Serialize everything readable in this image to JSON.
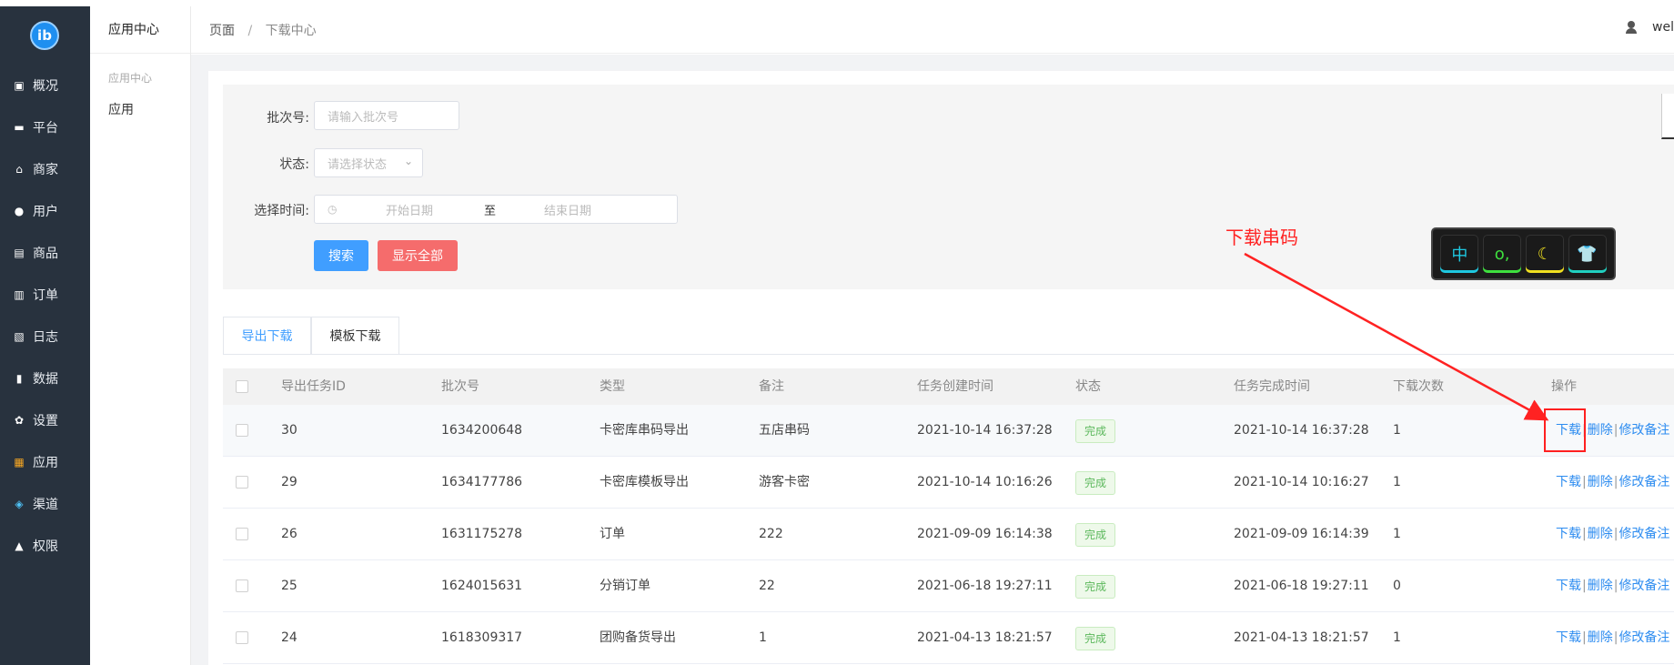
{
  "logo_text": "ib",
  "sidebar": {
    "items": [
      {
        "label": "概况",
        "icon": "overview-icon",
        "glyph": "▣"
      },
      {
        "label": "平台",
        "icon": "monitor-icon",
        "glyph": "▬"
      },
      {
        "label": "商家",
        "icon": "store-icon",
        "glyph": "⌂"
      },
      {
        "label": "用户",
        "icon": "user-icon",
        "glyph": "●"
      },
      {
        "label": "商品",
        "icon": "goods-icon",
        "glyph": "▤"
      },
      {
        "label": "订单",
        "icon": "order-icon",
        "glyph": "▥"
      },
      {
        "label": "日志",
        "icon": "log-icon",
        "glyph": "▧"
      },
      {
        "label": "数据",
        "icon": "bar-chart-icon",
        "glyph": "▮"
      },
      {
        "label": "设置",
        "icon": "gear-icon",
        "glyph": "✿"
      },
      {
        "label": "应用",
        "icon": "apps-grid-icon",
        "glyph": "▦"
      },
      {
        "label": "渠道",
        "icon": "cube-icon",
        "glyph": "◈"
      },
      {
        "label": "权限",
        "icon": "lock-icon",
        "glyph": "▲"
      }
    ]
  },
  "subnav": {
    "title": "应用中心",
    "group": "应用中心",
    "item": "应用"
  },
  "breadcrumb": {
    "root": "页面",
    "separator": "/",
    "current": "下载中心"
  },
  "user": {
    "name": "welia"
  },
  "filter": {
    "batch_label": "批次号:",
    "batch_placeholder": "请输入批次号",
    "status_label": "状态:",
    "status_placeholder": "请选择状态",
    "time_label": "选择时间:",
    "start_placeholder": "开始日期",
    "range_sep": "至",
    "end_placeholder": "结束日期",
    "search_btn": "搜索",
    "show_all_btn": "显示全部"
  },
  "tabs": [
    "导出下载",
    "模板下载"
  ],
  "table": {
    "headers": [
      "导出任务ID",
      "批次号",
      "类型",
      "备注",
      "任务创建时间",
      "状态",
      "任务完成时间",
      "下载次数",
      "操作"
    ],
    "rows": [
      {
        "id": "30",
        "batch": "1634200648",
        "type": "卡密库串码导出",
        "note": "五店串码",
        "created": "2021-10-14 16:37:28",
        "status": "完成",
        "finished": "2021-10-14 16:37:28",
        "downloads": "1"
      },
      {
        "id": "29",
        "batch": "1634177786",
        "type": "卡密库模板导出",
        "note": "游客卡密",
        "created": "2021-10-14 10:16:26",
        "status": "完成",
        "finished": "2021-10-14 10:16:27",
        "downloads": "1"
      },
      {
        "id": "26",
        "batch": "1631175278",
        "type": "订单",
        "note": "222",
        "created": "2021-09-09 16:14:38",
        "status": "完成",
        "finished": "2021-09-09 16:14:39",
        "downloads": "1"
      },
      {
        "id": "25",
        "batch": "1624015631",
        "type": "分销订单",
        "note": "22",
        "created": "2021-06-18 19:27:11",
        "status": "完成",
        "finished": "2021-06-18 19:27:11",
        "downloads": "0"
      },
      {
        "id": "24",
        "batch": "1618309317",
        "type": "团购备货导出",
        "note": "1",
        "created": "2021-04-13 18:21:57",
        "status": "完成",
        "finished": "2021-04-13 18:21:57",
        "downloads": "1"
      }
    ],
    "actions": {
      "download": "下载",
      "delete": "删除",
      "edit_note": "修改备注",
      "pipe": "|"
    }
  },
  "annotation": {
    "text": "下载串码",
    "color": "#ff2222"
  },
  "ime_toolbar": {
    "keys": [
      {
        "glyph": "中",
        "color": "#1ec8e0"
      },
      {
        "glyph": "o,",
        "color": "#3ee03e"
      },
      {
        "glyph": "☾",
        "color": "#f0e020"
      },
      {
        "glyph": "👕",
        "color": "#20d0c0"
      }
    ]
  },
  "colors": {
    "sidebar_bg": "#28323e",
    "primary": "#409eff",
    "danger": "#f56c6c",
    "link": "#2d8cf0",
    "success": "#5cb85c"
  }
}
